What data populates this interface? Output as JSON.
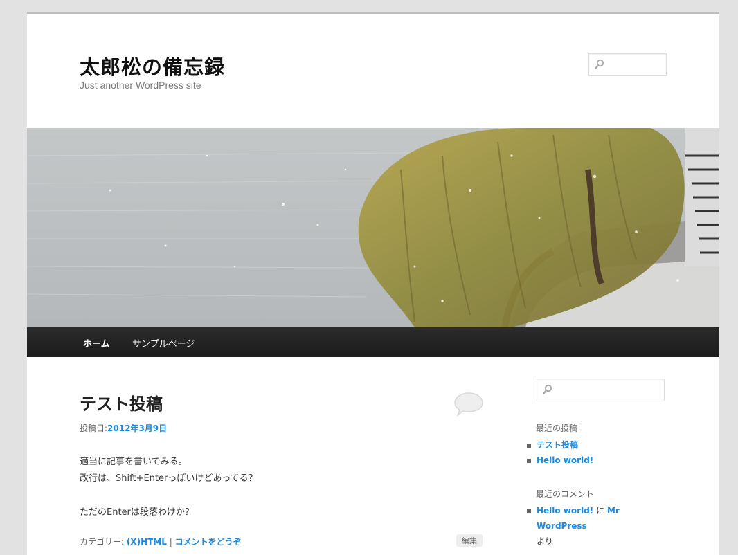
{
  "site": {
    "title": "太郎松の備忘録",
    "description": "Just another WordPress site"
  },
  "nav": {
    "items": [
      {
        "label": "ホーム",
        "current": true
      },
      {
        "label": "サンプルページ",
        "current": false
      }
    ]
  },
  "post": {
    "title": "テスト投稿",
    "meta_label": "投稿日:",
    "date": "2012年3月9日",
    "lines": [
      "適当に記事を書いてみる。",
      "改行は、Shift+Enterっぽいけどあってる？",
      "ただのEnterは段落わけか？"
    ],
    "category_label": "カテゴリー:",
    "category": "(X)HTML",
    "separator": "|",
    "comment_link": "コメントをどうぞ",
    "edit_label": "編集"
  },
  "sidebar": {
    "recent_posts_title": "最近の投稿",
    "recent_posts": [
      "テスト投稿",
      "Hello world!"
    ],
    "recent_comments_title": "最近のコメント",
    "recent_comment": {
      "post": "Hello world!",
      "connector": "に",
      "author": "Mr WordPress",
      "suffix": "より"
    }
  },
  "icons": {
    "search": "search-icon",
    "comment": "comment-bubble-icon"
  },
  "colors": {
    "link": "#1b8be0",
    "nav_bg": "#222222",
    "page_bg": "#e2e2e2"
  }
}
